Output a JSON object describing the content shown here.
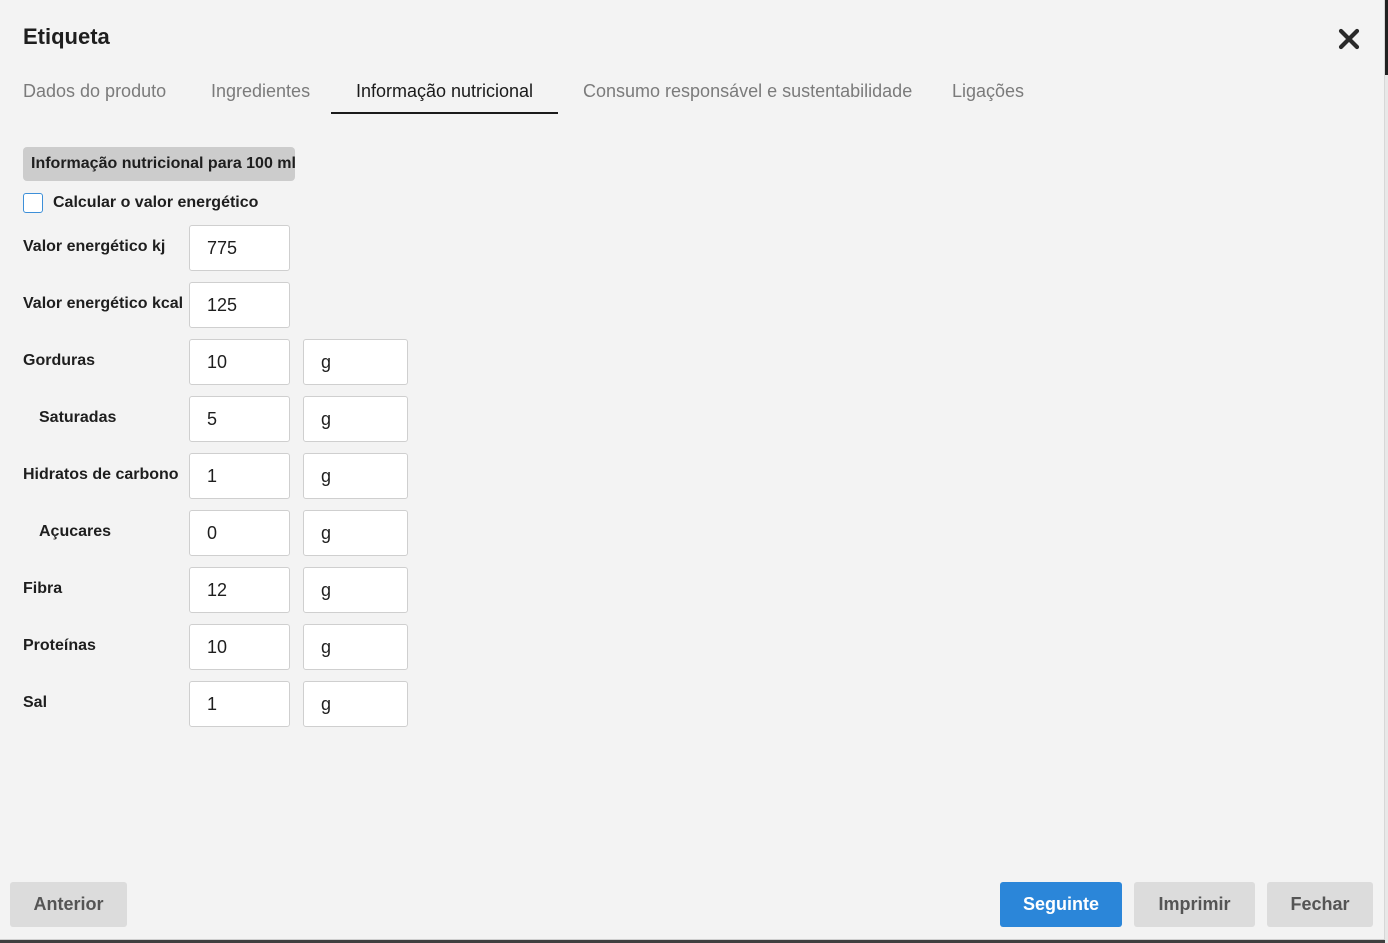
{
  "dialog": {
    "title": "Etiqueta"
  },
  "tabs": [
    {
      "label": "Dados do produto"
    },
    {
      "label": "Ingredientes"
    },
    {
      "label": "Informação nutricional"
    },
    {
      "label": "Consumo responsável e sustentabilidade"
    },
    {
      "label": "Ligações"
    }
  ],
  "active_tab": "Informação nutricional",
  "section": {
    "title": "Informação nutricional para 100 ml"
  },
  "calculate": {
    "label": "Calcular o valor energético",
    "checked": false
  },
  "rows": [
    {
      "label": "Valor energético kj",
      "value": "775"
    },
    {
      "label": "Valor energético kcal",
      "value": "125"
    },
    {
      "label": "Gorduras",
      "value": "10",
      "unit": "g"
    },
    {
      "label": "Saturadas",
      "value": "5",
      "unit": "g"
    },
    {
      "label": "Hidratos de carbono",
      "value": "1",
      "unit": "g"
    },
    {
      "label": "Açucares",
      "value": "0",
      "unit": "g"
    },
    {
      "label": "Fibra",
      "value": "12",
      "unit": "g"
    },
    {
      "label": "Proteínas",
      "value": "10",
      "unit": "g"
    },
    {
      "label": "Sal",
      "value": "1",
      "unit": "g"
    }
  ],
  "footer": {
    "previous_label": "Anterior",
    "next_label": "Seguinte",
    "print_label": "Imprimir",
    "close_label": "Fechar"
  },
  "colors": {
    "primary": "#2b86d9",
    "background": "#f3f3f3",
    "grey_button": "#dcdcdc"
  }
}
